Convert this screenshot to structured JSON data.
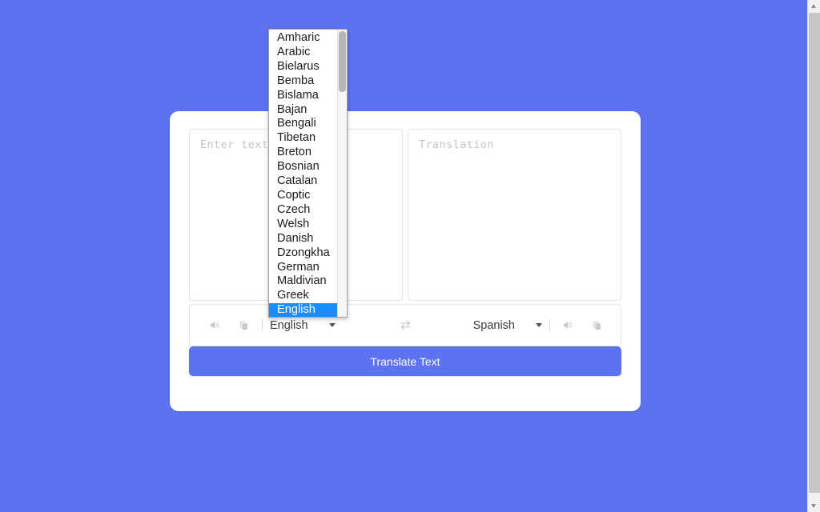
{
  "theme": {
    "page_background": "#5c72ef",
    "card_background": "#ffffff",
    "button_color": "#5c72ef",
    "dropdown_highlight": "#1a8cff",
    "placeholder_color": "#c4c4c8"
  },
  "card": {
    "source_editor": {
      "placeholder": "Enter text",
      "value": ""
    },
    "target_editor": {
      "placeholder": "Translation",
      "value": ""
    },
    "toolbar": {
      "source_listen_icon": "speaker-icon",
      "source_copy_icon": "copy-icon",
      "source_language": "English",
      "swap_icon": "swap-arrows-icon",
      "target_language": "Spanish",
      "target_listen_icon": "speaker-icon",
      "target_copy_icon": "copy-icon",
      "chevron_icon": "chevron-down-icon"
    },
    "translate_button": {
      "label": "Translate Text"
    }
  },
  "language_dropdown": {
    "open": true,
    "selected": "English",
    "options": [
      "Amharic",
      "Arabic",
      "Bielarus",
      "Bemba",
      "Bislama",
      "Bajan",
      "Bengali",
      "Tibetan",
      "Breton",
      "Bosnian",
      "Catalan",
      "Coptic",
      "Czech",
      "Welsh",
      "Danish",
      "Dzongkha",
      "German",
      "Maldivian",
      "Greek",
      "English"
    ]
  },
  "browser_scrollbar": {
    "up_arrow_icon": "scroll-up-arrow-icon",
    "down_arrow_icon": "scroll-down-arrow-icon"
  }
}
